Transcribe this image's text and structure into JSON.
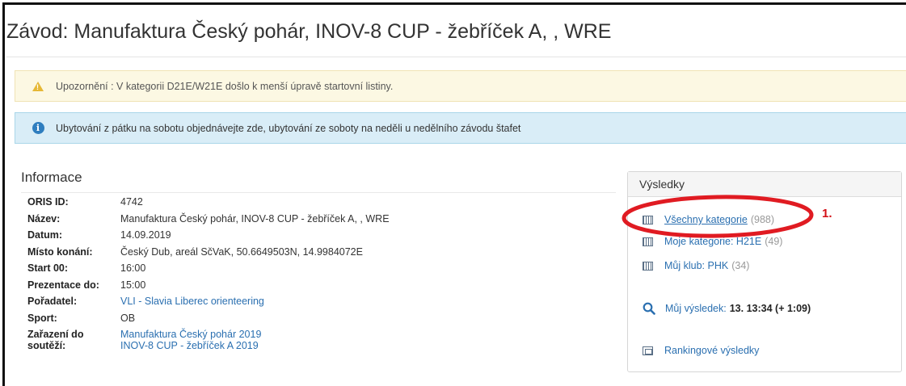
{
  "page": {
    "title": "Závod: Manufaktura Český pohár, INOV-8 CUP - žebříček A, , WRE"
  },
  "alerts": {
    "warning": {
      "text": "Upozornění : V kategorii D21E/W21E došlo k menší úpravě startovní listiny."
    },
    "info": {
      "text": "Ubytování z pátku na sobotu objednávejte zde, ubytování ze soboty na neděli u nedělního závodu štafet"
    }
  },
  "info": {
    "heading": "Informace",
    "rows": [
      {
        "label": "ORIS ID:",
        "value": "4742"
      },
      {
        "label": "Název:",
        "value": "Manufaktura Český pohár, INOV-8 CUP - žebříček A, , WRE"
      },
      {
        "label": "Datum:",
        "value": "14.09.2019"
      },
      {
        "label": "Místo konání:",
        "value": "Český Dub, areál SčVaK, 50.6649503N, 14.9984072E"
      },
      {
        "label": "Start 00:",
        "value": "16:00"
      },
      {
        "label": "Prezentace do:",
        "value": "15:00"
      },
      {
        "label": "Pořadatel:",
        "value": "VLI - Slavia Liberec orienteering"
      },
      {
        "label": "Sport:",
        "value": "OB"
      }
    ],
    "competition": {
      "label_line1": "Zařazení do",
      "label_line2": "soutěží:",
      "value_line1": "Manufaktura Český pohár 2019",
      "value_line2": "INOV-8 CUP - žebříček A 2019"
    }
  },
  "results": {
    "heading": "Výsledky",
    "all": {
      "label": "Všechny kategorie",
      "count": "(988)"
    },
    "mine": {
      "label": "Moje kategorie: H21E",
      "count": "(49)"
    },
    "club": {
      "label": "Můj klub: PHK",
      "count": "(34)"
    },
    "my_result": {
      "label": "Můj výsledek:",
      "value": "13.  13:34 (+ 1:09)"
    },
    "ranking": {
      "label": "Rankingové výsledky"
    }
  },
  "annotation": {
    "text": "1.",
    "color": "#d30f16"
  },
  "colors": {
    "link": "#2a6fb0",
    "warning_bg": "#fcf8e3",
    "info_bg": "#d9edf7"
  }
}
